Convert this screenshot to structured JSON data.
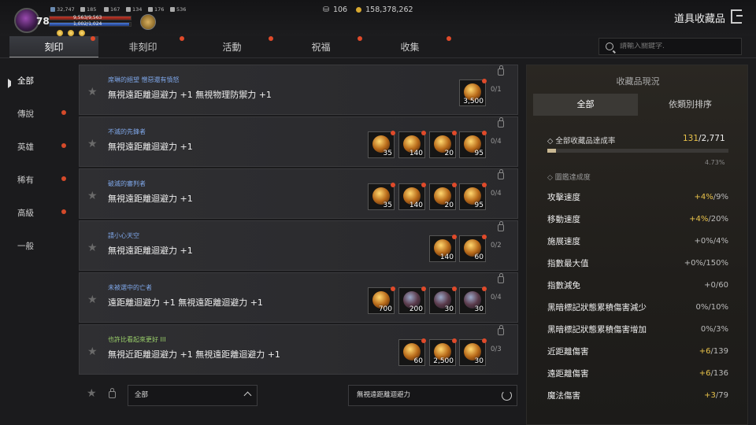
{
  "player": {
    "level": "78",
    "stats": [
      "32,747",
      "185",
      "167",
      "134",
      "176",
      "536"
    ],
    "hp_text": "9,563/9,563",
    "mp_text": "1,002/1,024"
  },
  "currency": {
    "silver": "106",
    "gold": "158,378,262"
  },
  "page_title": "道具收藏品",
  "tabs": [
    "刻印",
    "非刻印",
    "活動",
    "祝福",
    "收集"
  ],
  "search": {
    "placeholder": "請輸入關鍵字."
  },
  "sidebar": [
    "全部",
    "傳說",
    "英雄",
    "稀有",
    "高級",
    "一般"
  ],
  "cards": [
    {
      "name": "席琳的絕望 憎惡還有憤怒",
      "effect": "無視遠距離迴避力 +1 無視物理防禦力 +1",
      "progress": "0/1",
      "items": [
        "3,500"
      ]
    },
    {
      "name": "不滅的先鋒者",
      "effect": "無視遠距離迴避力 +1",
      "progress": "0/4",
      "items": [
        "35",
        "140",
        "20",
        "95"
      ]
    },
    {
      "name": "破滅的審判者",
      "effect": "無視遠距離迴避力 +1",
      "progress": "0/4",
      "items": [
        "35",
        "140",
        "20",
        "95"
      ]
    },
    {
      "name": "請小心天空",
      "effect": "無視遠距離迴避力 +1",
      "progress": "0/2",
      "items": [
        "140",
        "60"
      ]
    },
    {
      "name": "未被選中的亡者",
      "effect": "遠距離迴避力 +1 無視遠距離迴避力 +1",
      "progress": "0/4",
      "items": [
        "700",
        "200",
        "30",
        "30"
      ]
    },
    {
      "name": "也許比看起來更好 III",
      "effect": "無視近距離迴避力 +1 無視遠距離迴避力 +1",
      "progress": "0/3",
      "items": [
        "60",
        "2,500",
        "30"
      ]
    }
  ],
  "bottom": {
    "filter": "全部",
    "query": "無視遠距離迴避力"
  },
  "panel": {
    "title": "收藏品現況",
    "tabs": [
      "全部",
      "依類別排序"
    ],
    "completion_label": "全部收藏品達成率",
    "completion_current": "131",
    "completion_total": "/2,771",
    "completion_pct": "4.73%",
    "encyclopedia_label": "圖鑑達成度",
    "stats": [
      {
        "name": "攻擊速度",
        "gain": "+4%",
        "rest": "/9%"
      },
      {
        "name": "移動速度",
        "gain": "+4%",
        "rest": "/20%"
      },
      {
        "name": "施展速度",
        "gain": "",
        "rest": "+0%/4%"
      },
      {
        "name": "指數最大值",
        "gain": "",
        "rest": "+0%/150%"
      },
      {
        "name": "指數減免",
        "gain": "",
        "rest": "+0/60"
      },
      {
        "name": "黑暗標記狀態累積傷害減少",
        "gain": "",
        "rest": "0%/10%"
      },
      {
        "name": "黑暗標記狀態累積傷害增加",
        "gain": "",
        "rest": "0%/3%"
      },
      {
        "name": "近距離傷害",
        "gain": "+6",
        "rest": "/139"
      },
      {
        "name": "遠距離傷害",
        "gain": "+6",
        "rest": "/136"
      },
      {
        "name": "魔法傷害",
        "gain": "+3",
        "rest": "/79"
      }
    ]
  }
}
